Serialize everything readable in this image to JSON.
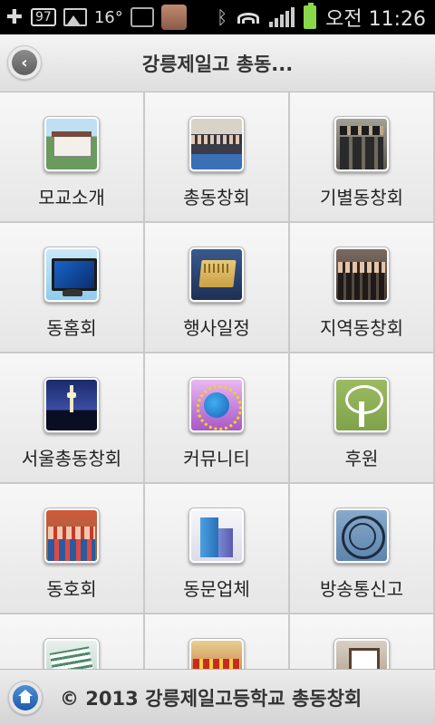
{
  "status_bar": {
    "notif_badge": "97",
    "temperature": "16°",
    "time": "오전 11:26"
  },
  "header": {
    "title": "강릉제일고 총동..."
  },
  "menu": [
    {
      "label": "모교소개",
      "icon": "school-building-icon",
      "art": "school"
    },
    {
      "label": "총동창회",
      "icon": "alumni-group-photo-icon",
      "art": "group"
    },
    {
      "label": "기별동창회",
      "icon": "class-reunion-photo-icon",
      "art": "uniform"
    },
    {
      "label": "동홈회",
      "icon": "monitor-icon",
      "art": "monitor"
    },
    {
      "label": "행사일정",
      "icon": "calendar-icon",
      "art": "calendar"
    },
    {
      "label": "지역동창회",
      "icon": "regional-group-photo-icon",
      "art": "crowd"
    },
    {
      "label": "서울총동창회",
      "icon": "seoul-tower-icon",
      "art": "tower"
    },
    {
      "label": "커뮤니티",
      "icon": "community-globe-icon",
      "art": "globe"
    },
    {
      "label": "후원",
      "icon": "tree-icon",
      "art": "tree"
    },
    {
      "label": "동호회",
      "icon": "club-hikers-photo-icon",
      "art": "hikers"
    },
    {
      "label": "동문업체",
      "icon": "buildings-icon",
      "art": "buildings"
    },
    {
      "label": "방송통신고",
      "icon": "school-seal-icon",
      "art": "seal"
    },
    {
      "label": "",
      "icon": "documents-icon",
      "art": "papers"
    },
    {
      "label": "",
      "icon": "event-photo-icon",
      "art": "dancers"
    },
    {
      "label": "",
      "icon": "picture-frame-icon",
      "art": "frame"
    }
  ],
  "footer": {
    "copyright": "© 2013 강릉제일고등학교 총동창회"
  }
}
